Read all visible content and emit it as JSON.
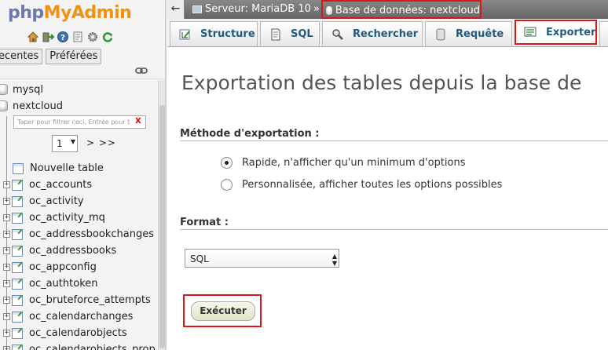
{
  "app": {
    "logo": {
      "php": "php",
      "my": "My",
      "admin": "Admin"
    },
    "colors": {
      "logo_php": "#6c78af",
      "logo_myadmin": "#f29111",
      "highlight": "#d9161a",
      "link": "#235a81"
    }
  },
  "sidebar": {
    "quicklink_icons": [
      "home-icon",
      "logout-icon",
      "help-icon",
      "docs-icon",
      "settings-icon",
      "reload-icon"
    ],
    "nav_tabs": [
      {
        "label": "ecentes"
      },
      {
        "label": "Préférées"
      }
    ],
    "databases": [
      {
        "label": "mysql"
      },
      {
        "label": "nextcloud"
      }
    ],
    "filter": {
      "placeholder": "Taper pour filtrer ceci, Entrée pour t",
      "clear_label": "X"
    },
    "pager": {
      "value": "1",
      "next_label": "> >>"
    },
    "new_table_label": "Nouvelle table",
    "tables": [
      "oc_accounts",
      "oc_activity",
      "oc_activity_mq",
      "oc_addressbookchanges",
      "oc_addressbooks",
      "oc_appconfig",
      "oc_authtoken",
      "oc_bruteforce_attempts",
      "oc_calendarchanges",
      "oc_calendarobjects",
      "oc_calendarobjects_prop"
    ]
  },
  "breadcrumb": {
    "back_label": "←",
    "server": "Serveur: MariaDB 10",
    "separator": "»",
    "database": "Base de données: nextcloud"
  },
  "tabs": [
    {
      "label": "Structure",
      "icon": "structure-icon"
    },
    {
      "label": "SQL",
      "icon": "sql-icon"
    },
    {
      "label": "Rechercher",
      "icon": "search-icon"
    },
    {
      "label": "Requête",
      "icon": "query-icon"
    },
    {
      "label": "Exporter",
      "icon": "export-icon",
      "active": true
    }
  ],
  "main": {
    "title": "Exportation des tables depuis la base de",
    "method": {
      "heading": "Méthode d'exportation :",
      "options": [
        {
          "label": "Rapide, n'afficher qu'un minimum d'options",
          "checked": true
        },
        {
          "label": "Personnalisée, afficher toutes les options possibles",
          "checked": false
        }
      ]
    },
    "format": {
      "heading": "Format :",
      "selected": "SQL"
    },
    "execute_label": "Exécuter"
  }
}
